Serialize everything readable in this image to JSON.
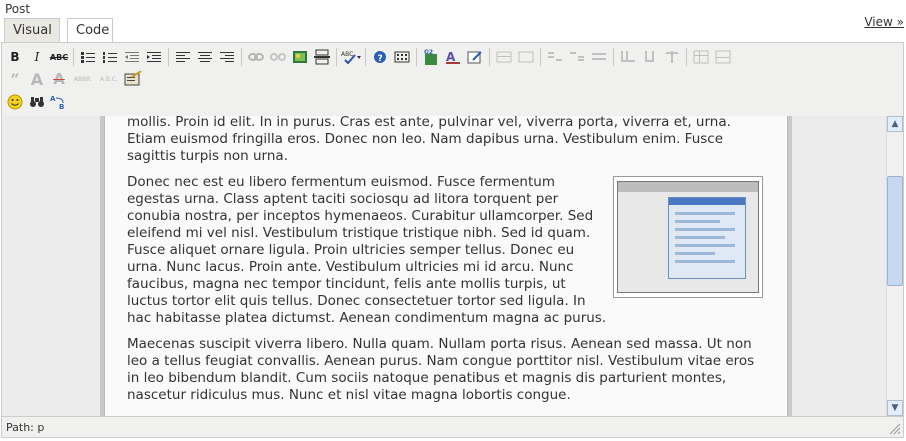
{
  "header": {
    "post_label": "Post",
    "view_link": "View »"
  },
  "tabs": [
    {
      "label": "Visual"
    },
    {
      "label": "Code"
    }
  ],
  "toolbar": {
    "row1": [
      "bold",
      "italic",
      "strikethrough",
      "bullet-list",
      "number-list",
      "outdent",
      "indent",
      "align-left",
      "align-center",
      "align-right",
      "link",
      "unlink",
      "image",
      "horizontal-rule",
      "spellcheck",
      "help",
      "charmap",
      "gallery",
      "font-color",
      "edit"
    ],
    "bold_label": "B",
    "italic_label": "I",
    "strike_label": "ABC"
  },
  "content": {
    "para1": "mollis. Proin id elit. In in purus. Cras est ante, pulvinar vel, viverra porta, viverra et, urna. Etiam euismod fringilla eros. Donec non leo. Nam dapibus urna. Vestibulum enim. Fusce sagittis turpis non urna.",
    "para2": "Donec nec est eu libero fermentum euismod. Fusce fermentum egestas urna. Class aptent taciti sociosqu ad litora torquent per conubia nostra, per inceptos hymenaeos. Curabitur ullamcorper. Sed eleifend mi vel nisl. Vestibulum tristique tristique nibh. Sed id quam. Fusce aliquet ornare ligula. Proin ultricies semper tellus. Donec eu urna. Nunc lacus. Proin ante. Vestibulum ultricies mi id arcu. Nunc faucibus, magna nec tempor tincidunt, felis ante mollis turpis, ut luctus tortor elit quis tellus. Donec consectetuer tortor sed ligula. In hac habitasse platea dictumst. Aenean condimentum magna ac purus.",
    "para3": "Maecenas suscipit viverra libero. Nulla quam. Nullam porta risus. Aenean sed massa. Ut non leo a tellus feugiat convallis. Aenean purus. Nam congue porttitor nisl. Vestibulum vitae eros in leo bibendum blandit. Cum sociis natoque penatibus et magnis dis parturient montes, nascetur ridiculus mus. Nunc et nisl vitae magna lobortis congue."
  },
  "status": {
    "path": "Path: p"
  }
}
